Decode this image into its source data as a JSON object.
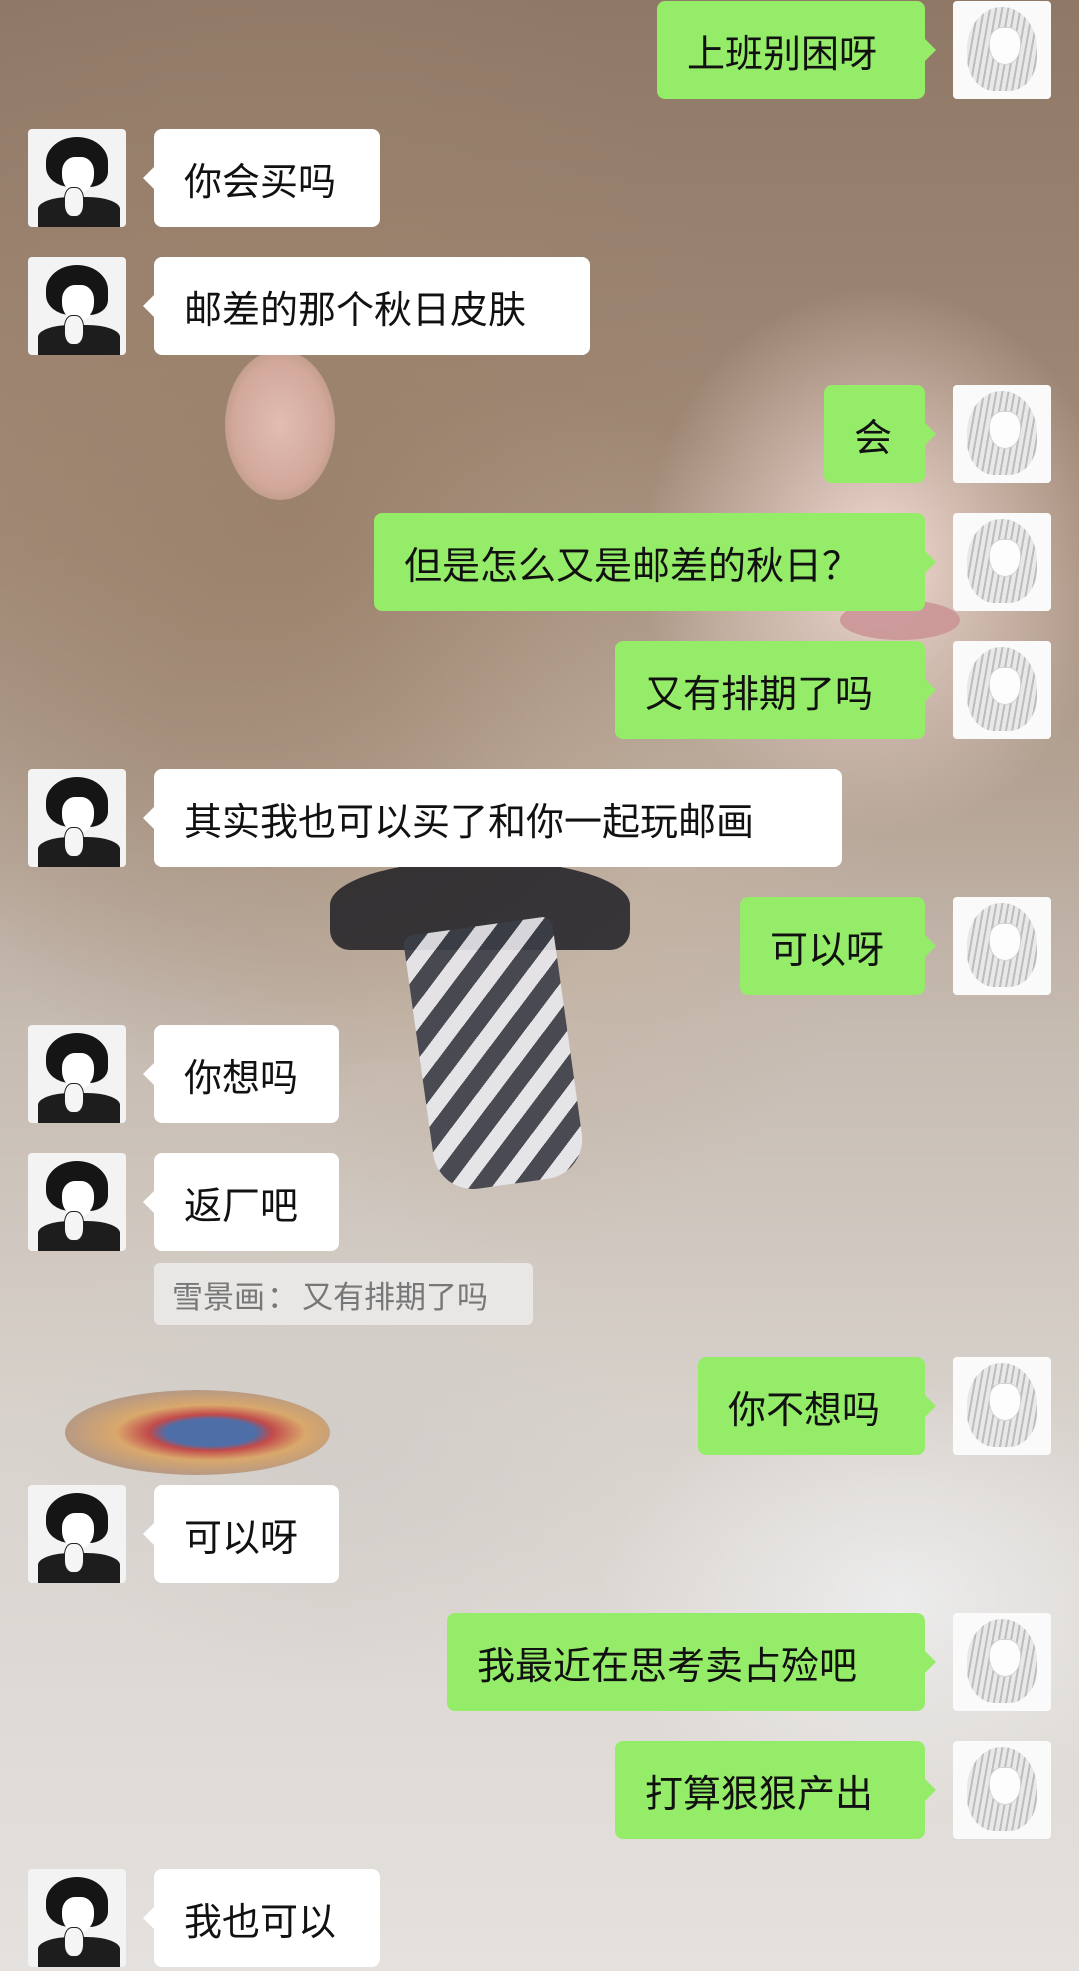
{
  "background": {
    "description_icon": "photo-background"
  },
  "colors": {
    "outgoing_bubble": "#95ec69",
    "incoming_bubble": "#ffffff",
    "quote_bg": "#ebebeb"
  },
  "avatars": {
    "self": "sketch-avatar-icon",
    "other": "dark-hair-avatar-icon"
  },
  "messages": [
    {
      "side": "right",
      "text": "上班别困呀"
    },
    {
      "side": "left",
      "text": "你会买吗"
    },
    {
      "side": "left",
      "text": "邮差的那个秋日皮肤"
    },
    {
      "side": "right",
      "text": "会"
    },
    {
      "side": "right",
      "text": "但是怎么又是邮差的秋日？"
    },
    {
      "side": "right",
      "text": "又有排期了吗"
    },
    {
      "side": "left",
      "text": "其实我也可以买了和你一起玩邮画"
    },
    {
      "side": "right",
      "text": "可以呀"
    },
    {
      "side": "left",
      "text": "你想吗"
    },
    {
      "side": "left",
      "text": "返厂吧"
    },
    {
      "side": "right",
      "text": "你不想吗"
    },
    {
      "side": "left",
      "text": "可以呀"
    },
    {
      "side": "right",
      "text": "我最近在思考卖占殓吧"
    },
    {
      "side": "right",
      "text": "打算狠狠产出"
    },
    {
      "side": "left",
      "text": "我也可以"
    }
  ],
  "quote": {
    "sender": "雪景画",
    "separator": "：",
    "text": "又有排期了吗"
  }
}
